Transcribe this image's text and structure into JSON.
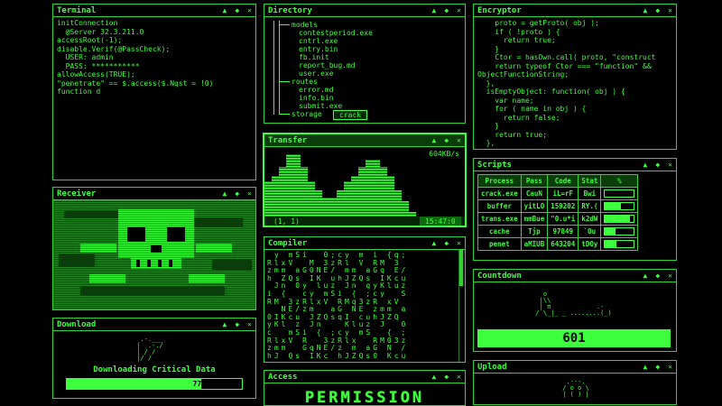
{
  "controls": {
    "minimize": "▲",
    "move": "◆",
    "close": "✕"
  },
  "terminal": {
    "title": "Terminal",
    "lines": [
      "initConnection",
      "  @Server 32.3.211.0",
      "accessRoot(-1);",
      "disable.Verif(@PassCheck);",
      "  USER: admin",
      "  PASS: ***********",
      "allowAccess(TRUE);",
      "\"penetrate\" == $.access($.Nqst = !0)",
      "function d"
    ]
  },
  "directory": {
    "title": "Directory",
    "items": [
      "models",
      "contestperiod.exe",
      "cntrl.exe",
      "entry.bin",
      "fb.init",
      "report_bug.md",
      "user.exe",
      "routes",
      "error.md",
      "info.bin",
      "submit.exe",
      "storage",
      "crack"
    ]
  },
  "encryptor": {
    "title": "Encryptor",
    "lines": [
      "    proto = getProto( obj );",
      "    if ( !proto ) {",
      "      return true;",
      "    }",
      "    Ctor = hasOwn.call( proto, \"construct",
      "    return typeof Ctor === \"function\" &&",
      "ObjectFunctionString;",
      "  },",
      "  isEmptyObject: function( obj ) {",
      "    var name;",
      "    for ( name in obj ) {",
      "      return false;",
      "    }",
      "    return true;",
      "  },"
    ]
  },
  "transfer": {
    "title": "Transfer",
    "rate": "604KB/s",
    "coords": "(1, 1)",
    "time": "15:47:0"
  },
  "receiver": {
    "title": "Receiver"
  },
  "scripts": {
    "title": "Scripts",
    "headers": [
      "Process",
      "Pass",
      "Code",
      "Stat",
      "%"
    ],
    "rows": [
      {
        "process": "crack.exe",
        "pass": "CauN",
        "code": "iL=rF",
        "stat": "Bwi",
        "pct": 0
      },
      {
        "process": "buffer",
        "pass": "yitLO",
        "code": "159202",
        "stat": "RY.(",
        "pct": 0.55
      },
      {
        "process": "trans.exe",
        "pass": "mmBue",
        "code": "\"0.u*i",
        "stat": "k2dW",
        "pct": 0.85
      },
      {
        "process": "cache",
        "pass": "Tjp",
        "code": "97849",
        "stat": "`Ou",
        "pct": 0.35
      },
      {
        "process": "penet",
        "pass": "aMIUB",
        "code": "643204",
        "stat": "tDOy",
        "pct": 0.4
      }
    ]
  },
  "compiler": {
    "title": "Compiler"
  },
  "countdown": {
    "title": "Countdown",
    "value": "601"
  },
  "download": {
    "title": "Download",
    "label": "Downloading Critical Data",
    "percent": "77%",
    "progress": 0.77
  },
  "access": {
    "title": "Access",
    "word": "PERMISSION"
  },
  "upload": {
    "title": "Upload"
  }
}
